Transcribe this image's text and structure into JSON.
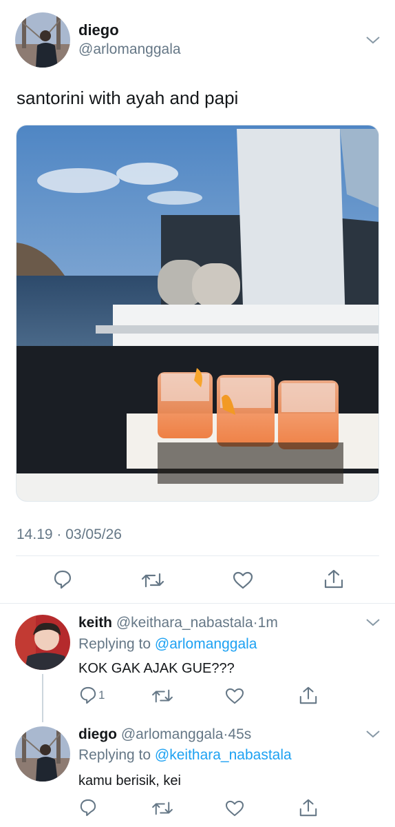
{
  "main_tweet": {
    "display_name": "diego",
    "handle": "@arlomanggala",
    "text": "santorini with ayah and papi",
    "timestamp": "14.19 · 03/05/26",
    "image_icon": "boat-drinks-photo"
  },
  "actions": {
    "reply_icon": "reply-icon",
    "retweet_icon": "retweet-icon",
    "like_icon": "heart-icon",
    "share_icon": "share-icon"
  },
  "replies": [
    {
      "display_name": "keith",
      "handle": "@keithara_nabastala",
      "separator": "·",
      "time": "1m",
      "replying_label": "Replying to",
      "replying_to": "@arlomanggala",
      "text": "KOK GAK AJAK GUE???",
      "reply_count": "1"
    },
    {
      "display_name": "diego",
      "handle": "@arlomanggala",
      "separator": "·",
      "time": "45s",
      "replying_label": "Replying to",
      "replying_to": "@keithara_nabastala",
      "text": "kamu berisik, kei"
    }
  ],
  "colors": {
    "link": "#1da1f2",
    "muted": "#657786",
    "text": "#14171a"
  }
}
